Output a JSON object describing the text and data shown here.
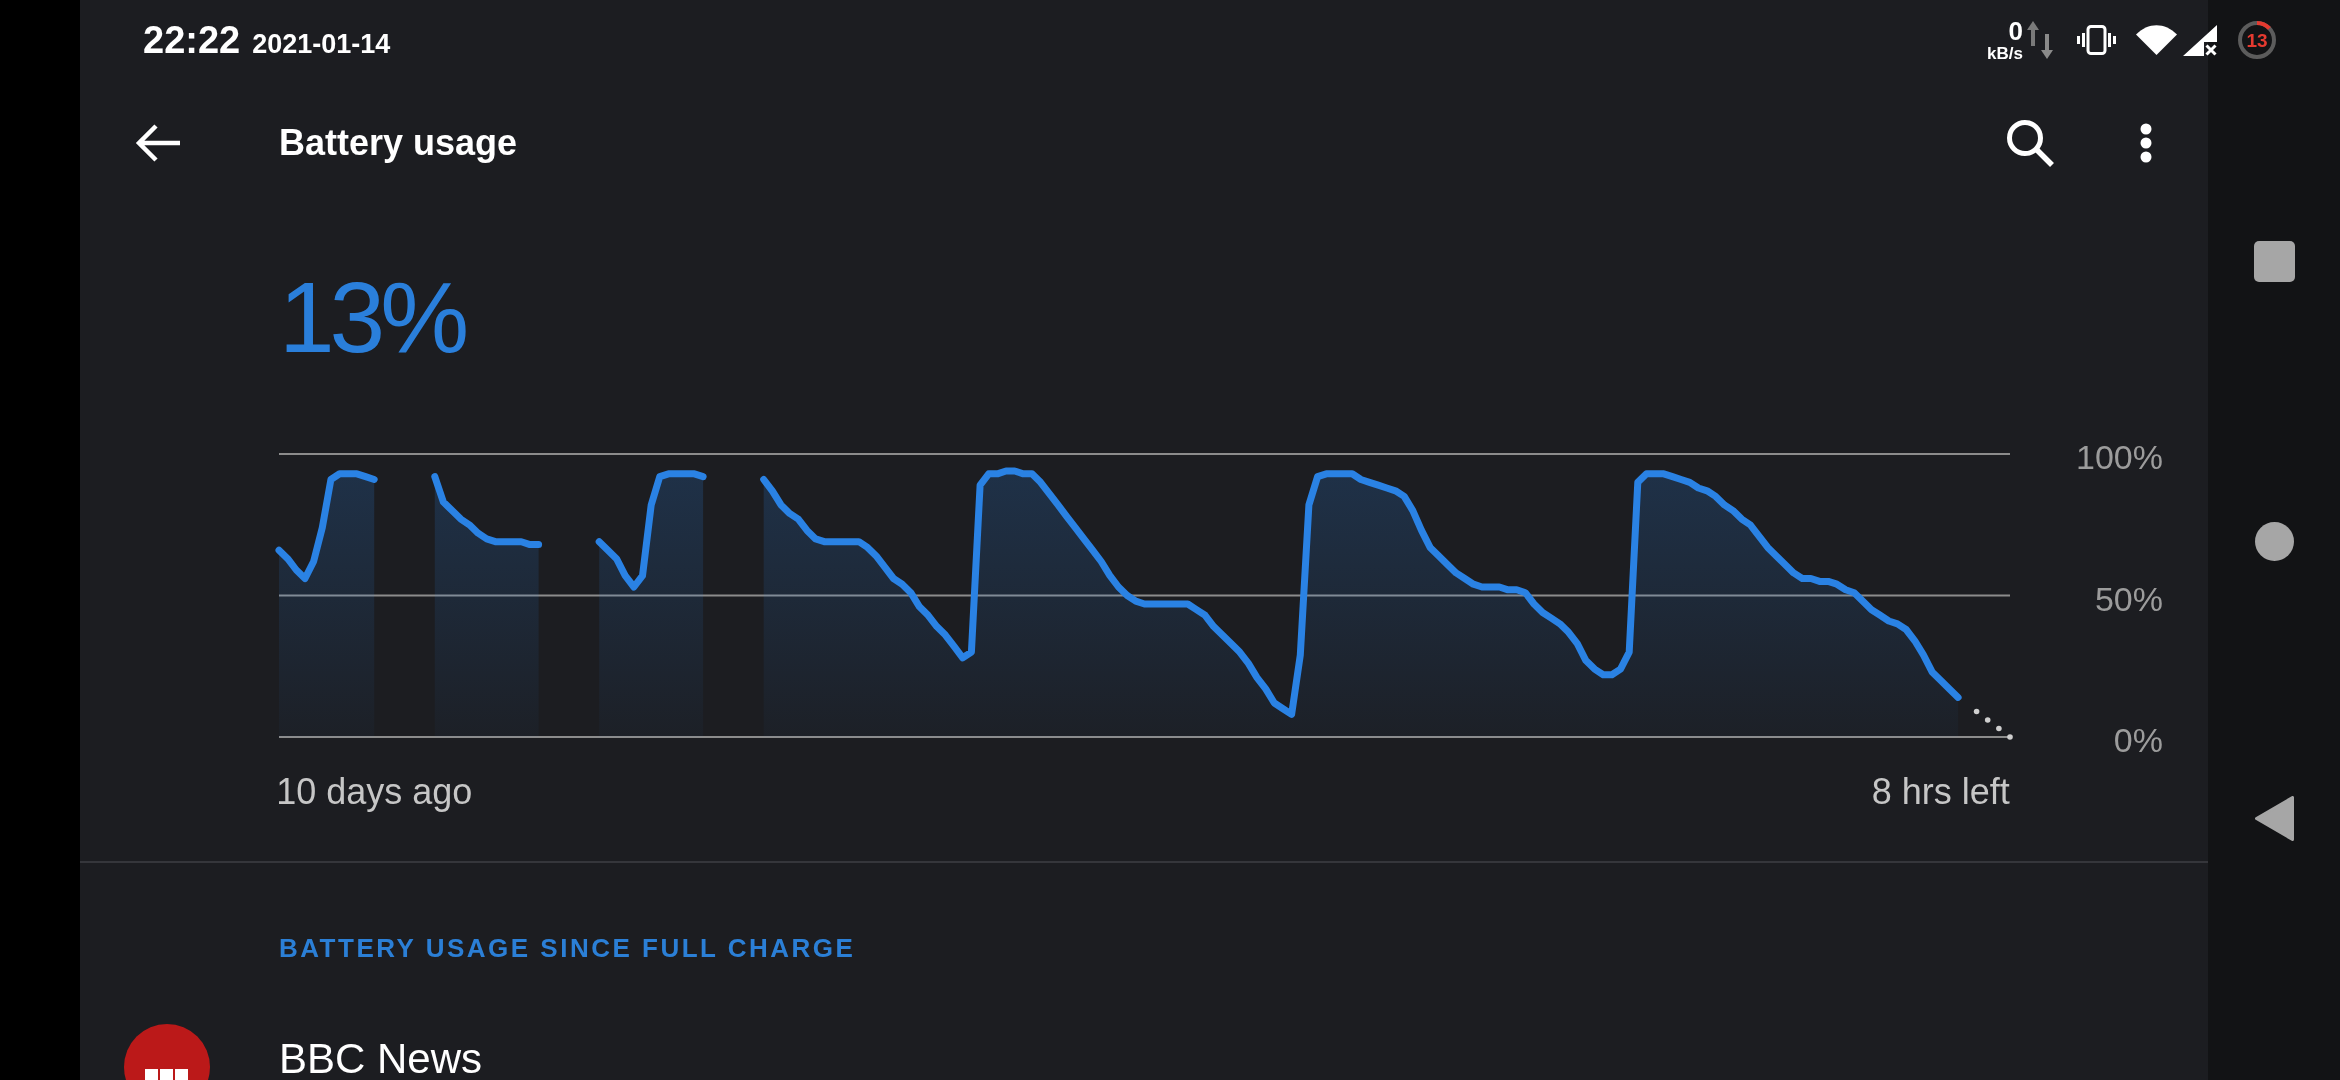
{
  "status_bar": {
    "time": "22:22",
    "date": "2021-01-14",
    "network_speed": {
      "value": "0",
      "unit": "kB/s"
    },
    "battery": "13"
  },
  "toolbar": {
    "title": "Battery usage"
  },
  "battery": {
    "percent": "13%",
    "chart_data": {
      "type": "area",
      "categories": [
        null,
        null,
        null,
        null,
        null,
        null,
        null,
        null,
        null,
        null,
        null,
        "10 days ago",
        null,
        null,
        null,
        null,
        null,
        null,
        null,
        null,
        null,
        null,
        null,
        null,
        null,
        null,
        null,
        null,
        null,
        null,
        null,
        null,
        null,
        null,
        null,
        null,
        null,
        null,
        null,
        null,
        null,
        null,
        null,
        null,
        null,
        null,
        null,
        null,
        null,
        null,
        null,
        null,
        null,
        null,
        null,
        null,
        null,
        null,
        null,
        null,
        null,
        null,
        null,
        null,
        null,
        null,
        null,
        null,
        null,
        null,
        null,
        null,
        null,
        null,
        null,
        null,
        null,
        null,
        null,
        null,
        null,
        null,
        null,
        null,
        null,
        null,
        null,
        null,
        null,
        null,
        null,
        null,
        null,
        null,
        null,
        null,
        null,
        null,
        null,
        null,
        null,
        null,
        null,
        null,
        null,
        null,
        null,
        null,
        null,
        null,
        null,
        null,
        null,
        null,
        null,
        null,
        null,
        null,
        null,
        null,
        null,
        null,
        null,
        null,
        null,
        null,
        null,
        null,
        null,
        null,
        null,
        null,
        null,
        null,
        null,
        null,
        null,
        null,
        null,
        null,
        null,
        null,
        null,
        null,
        null,
        null,
        null,
        null,
        null,
        null,
        null,
        null,
        null,
        null,
        null,
        null,
        null,
        null,
        null,
        null,
        null,
        null,
        null,
        null,
        null,
        null,
        null,
        null,
        null,
        null,
        null,
        null,
        null,
        null,
        null,
        null,
        null,
        null,
        null,
        null,
        null,
        null,
        null,
        null,
        null,
        null,
        null,
        null,
        null,
        null,
        null,
        null,
        "8 hrs left",
        null,
        null,
        null,
        null,
        null,
        null,
        null,
        null
      ],
      "series": [
        {
          "color": "#2a82e4",
          "values": [
            66,
            63,
            59,
            56,
            62,
            74,
            91,
            93,
            93,
            93,
            92,
            91,
            null,
            null,
            null,
            null,
            null,
            null,
            92,
            83,
            80,
            77,
            75,
            72,
            70,
            69,
            69,
            69,
            69,
            68,
            68,
            null,
            null,
            null,
            null,
            null,
            null,
            69,
            66,
            63,
            57,
            53,
            57,
            82,
            92,
            93,
            93,
            93,
            93,
            92,
            null,
            null,
            null,
            null,
            null,
            null,
            91,
            87,
            82,
            79,
            77,
            73,
            70,
            69,
            69,
            69,
            69,
            69,
            67,
            64,
            60,
            56,
            54,
            51,
            46,
            43,
            39,
            36,
            32,
            28,
            30,
            89,
            93,
            93,
            94,
            94,
            93,
            93,
            90,
            86,
            82,
            78,
            74,
            70,
            66,
            62,
            57,
            53,
            50,
            48,
            47,
            47,
            47,
            47,
            47,
            47,
            45,
            43,
            39,
            36,
            33,
            30,
            26,
            21,
            17,
            12,
            10,
            8,
            29,
            82,
            92,
            93,
            93,
            93,
            93,
            91,
            90,
            89,
            88,
            87,
            85,
            80,
            73,
            67,
            64,
            61,
            58,
            56,
            54,
            53,
            53,
            53,
            52,
            52,
            51,
            47,
            44,
            42,
            40,
            37,
            33,
            27,
            24,
            22,
            22,
            24,
            30,
            90,
            93,
            93,
            93,
            92,
            91,
            90,
            88,
            87,
            85,
            82,
            80,
            77,
            75,
            71,
            67,
            64,
            61,
            58,
            56,
            56,
            55,
            55,
            54,
            52,
            51,
            48,
            45,
            43,
            41,
            40,
            38,
            34,
            29,
            23,
            20,
            17,
            14,
            null,
            null,
            null,
            null,
            null,
            null
          ]
        }
      ],
      "ylim": [
        0,
        100
      ],
      "yticks": [
        {
          "value": 100,
          "label": "100%"
        },
        {
          "value": 50,
          "label": "50%"
        },
        {
          "value": 0,
          "label": "0%"
        }
      ]
    }
  },
  "section": {
    "title": "BATTERY USAGE SINCE FULL CHARGE"
  },
  "apps": [
    {
      "name": "BBC News"
    }
  ]
}
